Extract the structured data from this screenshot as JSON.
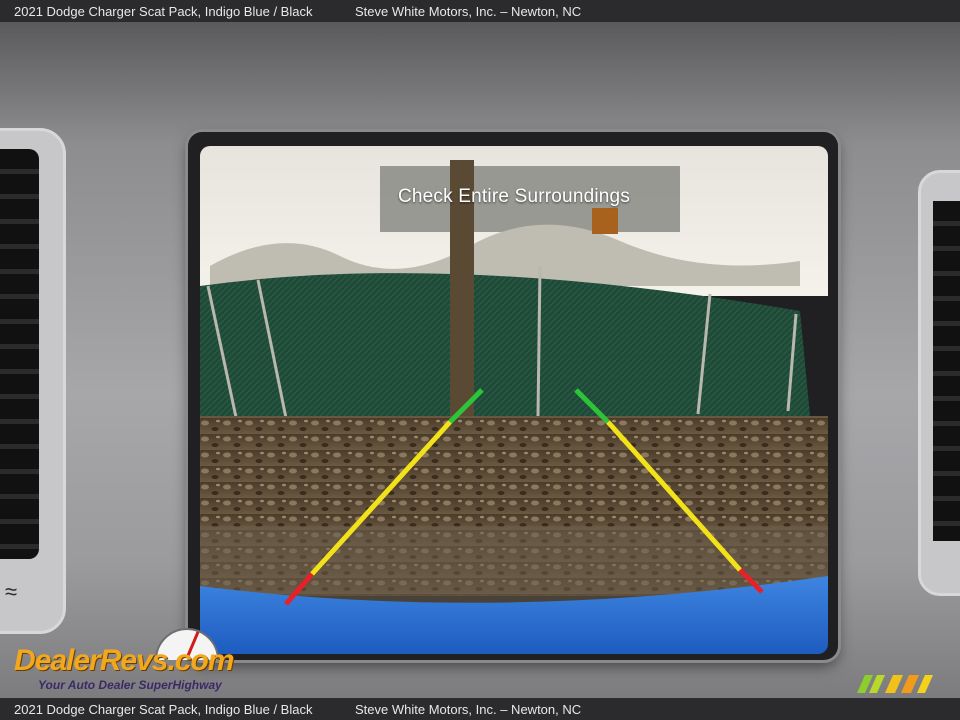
{
  "caption": {
    "vehicle": "2021 Dodge Charger Scat Pack,  Indigo Blue / Black",
    "dealer": "Steve White Motors, Inc.  –  Newton, NC"
  },
  "camera": {
    "warning_text": "Check Entire Surroundings"
  },
  "watermark": {
    "brand": "DealerRevs.com",
    "tagline": "Your Auto Dealer SuperHighway"
  },
  "colors": {
    "guide_near": "#e8202a",
    "guide_mid": "#f2e21a",
    "guide_far": "#2ec43a",
    "fence": "#1f4a38",
    "ground": "#5b4a33",
    "bumper": "#2a6fd0"
  },
  "icons": {
    "vent_airflow": "airflow-icon",
    "logo": "wmm-logo-icon"
  }
}
